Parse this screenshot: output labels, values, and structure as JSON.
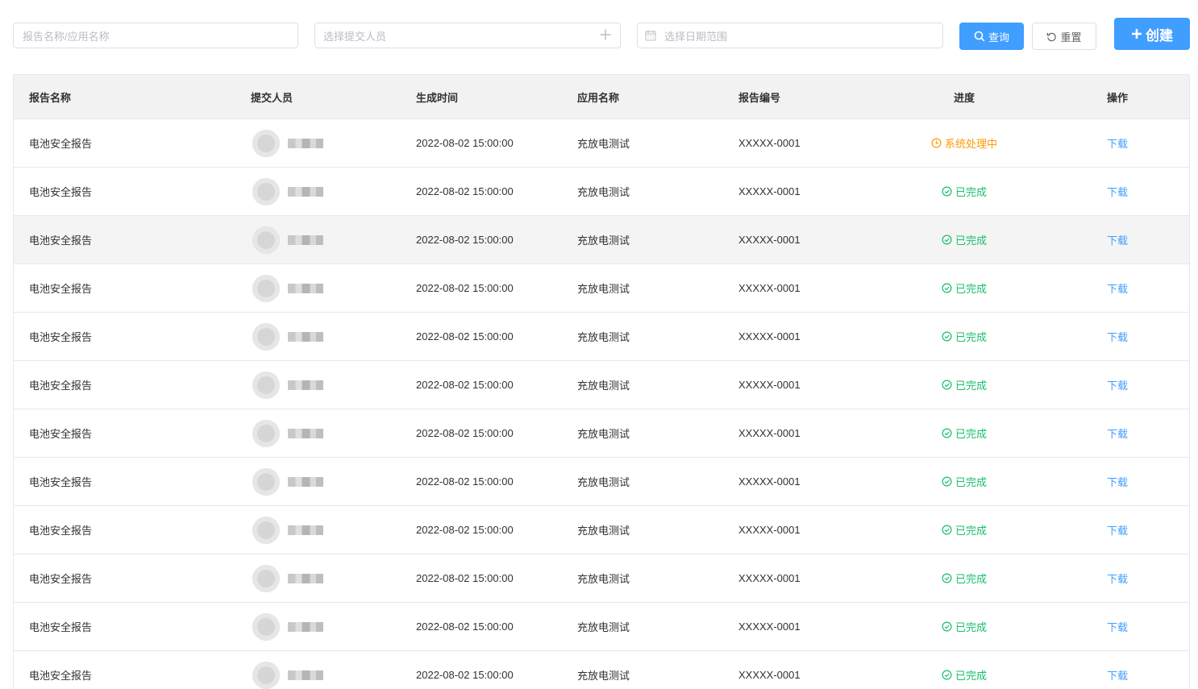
{
  "filters": {
    "name_placeholder": "报告名称/应用名称",
    "person_placeholder": "选择提交人员",
    "date_placeholder": "选择日期范围"
  },
  "buttons": {
    "query": "查询",
    "reset": "重置",
    "create": "创建"
  },
  "table": {
    "columns": [
      "报告名称",
      "提交人员",
      "生成时间",
      "应用名称",
      "报告编号",
      "进度",
      "操作"
    ],
    "rows": [
      {
        "name": "电池安全报告",
        "time": "2022-08-02 15:00:00",
        "app": "充放电测试",
        "code": "XXXXX-0001",
        "status": "系统处理中",
        "status_type": "processing",
        "op": "下载"
      },
      {
        "name": "电池安全报告",
        "time": "2022-08-02 15:00:00",
        "app": "充放电测试",
        "code": "XXXXX-0001",
        "status": "已完成",
        "status_type": "done",
        "op": "下载"
      },
      {
        "name": "电池安全报告",
        "time": "2022-08-02 15:00:00",
        "app": "充放电测试",
        "code": "XXXXX-0001",
        "status": "已完成",
        "status_type": "done",
        "op": "下载",
        "highlighted": true
      },
      {
        "name": "电池安全报告",
        "time": "2022-08-02 15:00:00",
        "app": "充放电测试",
        "code": "XXXXX-0001",
        "status": "已完成",
        "status_type": "done",
        "op": "下载"
      },
      {
        "name": "电池安全报告",
        "time": "2022-08-02 15:00:00",
        "app": "充放电测试",
        "code": "XXXXX-0001",
        "status": "已完成",
        "status_type": "done",
        "op": "下载"
      },
      {
        "name": "电池安全报告",
        "time": "2022-08-02 15:00:00",
        "app": "充放电测试",
        "code": "XXXXX-0001",
        "status": "已完成",
        "status_type": "done",
        "op": "下载"
      },
      {
        "name": "电池安全报告",
        "time": "2022-08-02 15:00:00",
        "app": "充放电测试",
        "code": "XXXXX-0001",
        "status": "已完成",
        "status_type": "done",
        "op": "下载"
      },
      {
        "name": "电池安全报告",
        "time": "2022-08-02 15:00:00",
        "app": "充放电测试",
        "code": "XXXXX-0001",
        "status": "已完成",
        "status_type": "done",
        "op": "下载"
      },
      {
        "name": "电池安全报告",
        "time": "2022-08-02 15:00:00",
        "app": "充放电测试",
        "code": "XXXXX-0001",
        "status": "已完成",
        "status_type": "done",
        "op": "下载"
      },
      {
        "name": "电池安全报告",
        "time": "2022-08-02 15:00:00",
        "app": "充放电测试",
        "code": "XXXXX-0001",
        "status": "已完成",
        "status_type": "done",
        "op": "下载"
      },
      {
        "name": "电池安全报告",
        "time": "2022-08-02 15:00:00",
        "app": "充放电测试",
        "code": "XXXXX-0001",
        "status": "已完成",
        "status_type": "done",
        "op": "下载"
      },
      {
        "name": "电池安全报告",
        "time": "2022-08-02 15:00:00",
        "app": "充放电测试",
        "code": "XXXXX-0001",
        "status": "已完成",
        "status_type": "done",
        "op": "下载"
      }
    ]
  },
  "colors": {
    "primary": "#409eff",
    "done": "#19be6b",
    "processing": "#ff9900"
  },
  "icons": {
    "query": "search-icon",
    "reset": "refresh-icon",
    "create": "plus-icon",
    "person_add": "plus-icon",
    "date": "calendar-icon",
    "done": "check-circle-icon",
    "processing": "clock-icon"
  }
}
